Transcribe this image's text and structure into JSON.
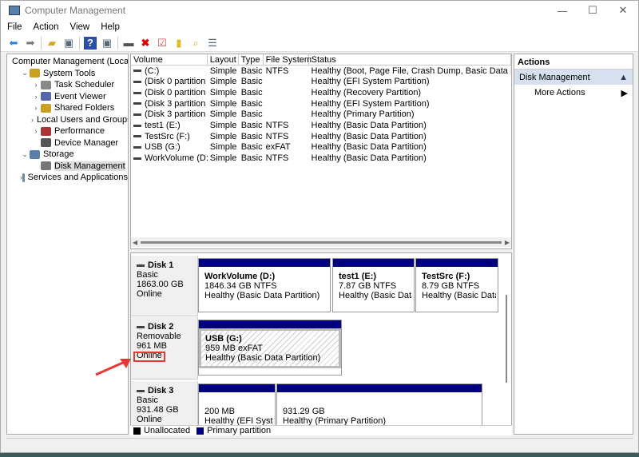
{
  "window": {
    "title": "Computer Management",
    "controls": [
      "—",
      "☐",
      "✕"
    ]
  },
  "menu": [
    "File",
    "Action",
    "View",
    "Help"
  ],
  "toolbar_icons": [
    "back-icon",
    "forward-icon",
    "up-folder-icon",
    "show-hide-tree-icon",
    "help-icon",
    "show-hide-action-icon",
    "connect-icon",
    "delete-icon",
    "properties-icon",
    "export-icon",
    "search-icon",
    "list-icon"
  ],
  "tree": [
    {
      "label": "Computer Management (Local",
      "level": 0,
      "expander": ""
    },
    {
      "label": "System Tools",
      "level": 1,
      "expander": "⌄"
    },
    {
      "label": "Task Scheduler",
      "level": 2,
      "expander": "›"
    },
    {
      "label": "Event Viewer",
      "level": 2,
      "expander": "›"
    },
    {
      "label": "Shared Folders",
      "level": 2,
      "expander": "›"
    },
    {
      "label": "Local Users and Groups",
      "level": 2,
      "expander": "›"
    },
    {
      "label": "Performance",
      "level": 2,
      "expander": "›"
    },
    {
      "label": "Device Manager",
      "level": 2,
      "expander": ""
    },
    {
      "label": "Storage",
      "level": 1,
      "expander": "⌄"
    },
    {
      "label": "Disk Management",
      "level": 2,
      "expander": "",
      "selected": true
    },
    {
      "label": "Services and Applications",
      "level": 1,
      "expander": "›"
    }
  ],
  "volumes": {
    "columns": [
      "Volume",
      "Layout",
      "Type",
      "File System",
      "Status"
    ],
    "rows": [
      [
        "(C:)",
        "Simple",
        "Basic",
        "NTFS",
        "Healthy (Boot, Page File, Crash Dump, Basic Data Partition)"
      ],
      [
        "(Disk 0 partition 1)",
        "Simple",
        "Basic",
        "",
        "Healthy (EFI System Partition)"
      ],
      [
        "(Disk 0 partition 4)",
        "Simple",
        "Basic",
        "",
        "Healthy (Recovery Partition)"
      ],
      [
        "(Disk 3 partition 1)",
        "Simple",
        "Basic",
        "",
        "Healthy (EFI System Partition)"
      ],
      [
        "(Disk 3 partition 2)",
        "Simple",
        "Basic",
        "",
        "Healthy (Primary Partition)"
      ],
      [
        "test1 (E:)",
        "Simple",
        "Basic",
        "NTFS",
        "Healthy (Basic Data Partition)"
      ],
      [
        "TestSrc (F:)",
        "Simple",
        "Basic",
        "NTFS",
        "Healthy (Basic Data Partition)"
      ],
      [
        "USB (G:)",
        "Simple",
        "Basic",
        "exFAT",
        "Healthy (Basic Data Partition)"
      ],
      [
        "WorkVolume (D:)",
        "Simple",
        "Basic",
        "NTFS",
        "Healthy (Basic Data Partition)"
      ]
    ]
  },
  "disks": [
    {
      "name": "Disk 1",
      "type": "Basic",
      "size": "1863.00 GB",
      "state": "Online",
      "partitions": [
        {
          "name": "WorkVolume  (D:)",
          "size": "1846.34 GB NTFS",
          "status": "Healthy (Basic Data Partition)"
        },
        {
          "name": "test1  (E:)",
          "size": "7.87 GB NTFS",
          "status": "Healthy (Basic Data Pa"
        },
        {
          "name": "TestSrc  (F:)",
          "size": "8.79 GB NTFS",
          "status": "Healthy (Basic Data Pa"
        }
      ]
    },
    {
      "name": "Disk 2",
      "type": "Removable",
      "size": "961 MB",
      "state": "Online",
      "partitions": [
        {
          "name": "USB  (G:)",
          "size": "959 MB exFAT",
          "status": "Healthy (Basic Data Partition)"
        }
      ]
    },
    {
      "name": "Disk 3",
      "type": "Basic",
      "size": "931.48 GB",
      "state": "Online",
      "partitions": [
        {
          "name": "",
          "size": "200 MB",
          "status": "Healthy (EFI System"
        },
        {
          "name": "",
          "size": "931.29 GB",
          "status": "Healthy (Primary Partition)"
        }
      ]
    }
  ],
  "legend": [
    {
      "label": "Unallocated",
      "color": "#000000"
    },
    {
      "label": "Primary partition",
      "color": "#00007f"
    }
  ],
  "actions": {
    "title": "Actions",
    "section": "Disk Management",
    "more": "More Actions"
  },
  "colors": {
    "primary_partition": "#00007f",
    "highlight": "#e53935"
  }
}
